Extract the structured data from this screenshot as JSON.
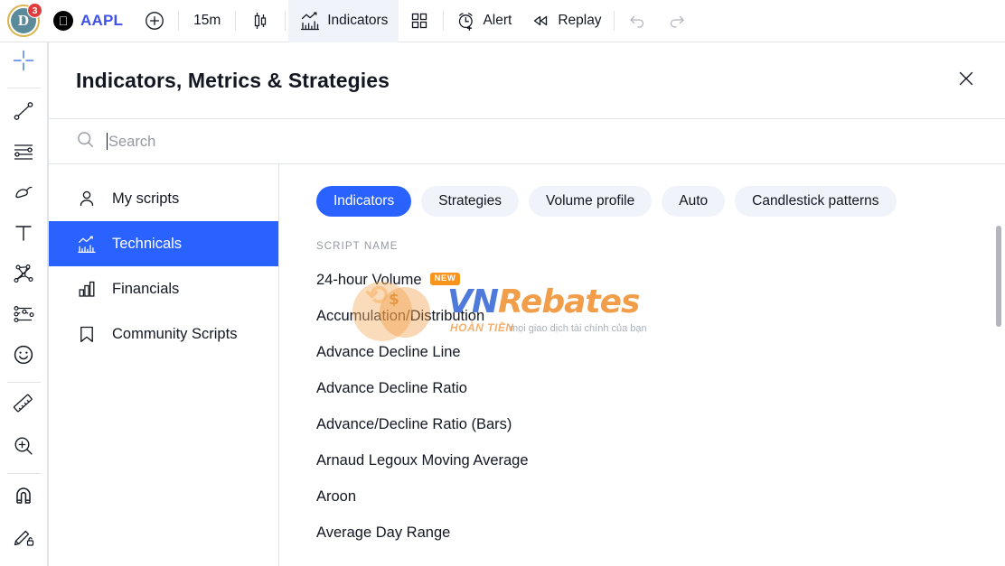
{
  "topbar": {
    "avatar": {
      "initial": "D",
      "badge_count": "3"
    },
    "symbol": {
      "ticker": "AAPL",
      "logo_icon": "apple-logo-icon"
    },
    "add_symbol_icon": "plus-circle-icon",
    "timeframe": "15m",
    "chart_type_icon": "candlestick-icon",
    "indicators_label": "Indicators",
    "indicators_icon": "indicators-chart-icon",
    "layout_icon": "grid-layout-icon",
    "alert_label": "Alert",
    "alert_icon": "alarm-clock-plus-icon",
    "replay_label": "Replay",
    "replay_icon": "rewind-icon",
    "undo_icon": "undo-arrow-icon",
    "redo_icon": "redo-arrow-icon"
  },
  "left_toolbar": {
    "tools": [
      {
        "name": "crosshair-cursor-tool",
        "icon": "crosshair-icon",
        "active": true
      },
      {
        "name": "trend-line-tool",
        "icon": "trend-line-icon",
        "active": false
      },
      {
        "name": "fib-retracement-tool",
        "icon": "fib-lines-icon",
        "active": false
      },
      {
        "name": "brush-tool",
        "icon": "brush-icon",
        "active": false
      },
      {
        "name": "text-tool",
        "icon": "text-t-icon",
        "active": false
      },
      {
        "name": "patterns-tool",
        "icon": "xabcd-pattern-icon",
        "active": false
      },
      {
        "name": "prediction-tool",
        "icon": "forecast-icon",
        "active": false
      },
      {
        "name": "emoji-tool",
        "icon": "smiley-icon",
        "active": false
      },
      {
        "name": "measure-tool",
        "icon": "ruler-icon",
        "active": false
      },
      {
        "name": "zoom-in-tool",
        "icon": "magnifier-plus-icon",
        "active": false
      },
      {
        "name": "magnet-mode-tool",
        "icon": "magnet-icon",
        "active": false
      },
      {
        "name": "lock-drawings-tool",
        "icon": "pencil-lock-icon",
        "active": false
      }
    ]
  },
  "dialog": {
    "title": "Indicators, Metrics & Strategies",
    "close_icon": "close-x-icon",
    "search": {
      "placeholder": "Search",
      "value": "",
      "icon": "search-icon"
    },
    "nav": [
      {
        "label": "My scripts",
        "icon": "person-icon",
        "active": false
      },
      {
        "label": "Technicals",
        "icon": "technicals-chart-icon",
        "active": true
      },
      {
        "label": "Financials",
        "icon": "bar-chart-icon",
        "active": false
      },
      {
        "label": "Community Scripts",
        "icon": "bookmark-icon",
        "active": false
      }
    ],
    "filters": [
      {
        "label": "Indicators",
        "active": true
      },
      {
        "label": "Strategies",
        "active": false
      },
      {
        "label": "Volume profile",
        "active": false
      },
      {
        "label": "Auto",
        "active": false
      },
      {
        "label": "Candlestick patterns",
        "active": false
      }
    ],
    "column_header": "SCRIPT NAME",
    "scripts": [
      {
        "name": "24-hour Volume",
        "badge": "NEW"
      },
      {
        "name": "Accumulation/Distribution",
        "badge": ""
      },
      {
        "name": "Advance Decline Line",
        "badge": ""
      },
      {
        "name": "Advance Decline Ratio",
        "badge": ""
      },
      {
        "name": "Advance/Decline Ratio (Bars)",
        "badge": ""
      },
      {
        "name": "Arnaud Legoux Moving Average",
        "badge": ""
      },
      {
        "name": "Aroon",
        "badge": ""
      },
      {
        "name": "Average Day Range",
        "badge": ""
      }
    ]
  },
  "watermark": {
    "brand_prefix": "VN",
    "brand_suffix": "Rebates",
    "label": "HOÀN TIỀN",
    "tagline": "mọi giao dịch tài chính của bạn"
  },
  "colors": {
    "accent_blue": "#2962ff",
    "symbol_blue": "#3f51e8",
    "badge_orange": "#f7941e",
    "badge_red": "#e23b3b",
    "border": "#e0e3eb",
    "muted_text": "#9598a1"
  }
}
